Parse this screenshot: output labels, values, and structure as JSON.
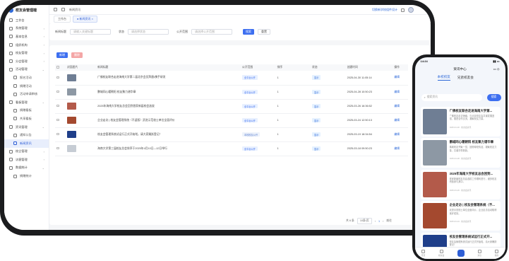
{
  "app": {
    "title": "校友会管理端"
  },
  "sidebar": {
    "items": [
      {
        "label": "工作台",
        "sub": false,
        "active": false,
        "chev": ""
      },
      {
        "label": "系统管理",
        "sub": false,
        "active": false,
        "chev": "›"
      },
      {
        "label": "基本信息",
        "sub": false,
        "active": false,
        "chev": "›"
      },
      {
        "label": "组织机构",
        "sub": false,
        "active": false,
        "chev": "›"
      },
      {
        "label": "校友管理",
        "sub": false,
        "active": false,
        "chev": "›"
      },
      {
        "label": "分会管理",
        "sub": false,
        "active": false,
        "chev": "›"
      },
      {
        "label": "活动管理",
        "sub": false,
        "active": false,
        "chev": "⌄"
      },
      {
        "label": "报名活动",
        "sub": true,
        "active": false,
        "chev": ""
      },
      {
        "label": "捐赠活动",
        "sub": true,
        "active": false,
        "chev": ""
      },
      {
        "label": "活动申请审核",
        "sub": true,
        "active": false,
        "chev": ""
      },
      {
        "label": "看板管理",
        "sub": false,
        "active": false,
        "chev": "⌄"
      },
      {
        "label": "捐赠看板",
        "sub": true,
        "active": false,
        "chev": ""
      },
      {
        "label": "共享看板",
        "sub": true,
        "active": false,
        "chev": ""
      },
      {
        "label": "资讯管理",
        "sub": false,
        "active": false,
        "chev": "⌄"
      },
      {
        "label": "通知公告",
        "sub": true,
        "active": false,
        "chev": ""
      },
      {
        "label": "新闻资讯",
        "sub": true,
        "active": true,
        "chev": ""
      },
      {
        "label": "校企管理",
        "sub": false,
        "active": false,
        "chev": "›"
      },
      {
        "label": "访客管理",
        "sub": false,
        "active": false,
        "chev": "›"
      },
      {
        "label": "数据统计",
        "sub": false,
        "active": false,
        "chev": "⌄"
      },
      {
        "label": "捐赠统计",
        "sub": true,
        "active": false,
        "chev": ""
      }
    ]
  },
  "topbar": {
    "breadcrumb": "新闻资讯",
    "link": "切换新学校组件设计"
  },
  "tabs": [
    {
      "label": "工作台",
      "on": false
    },
    {
      "label": "● 新闻资讯 ×",
      "on": true
    }
  ],
  "filters": {
    "title_label": "新闻标题",
    "title_ph": "请输入关键标题",
    "status_label": "状态",
    "status_ph": "请选择状态",
    "public_label": "公开范围",
    "public_ph": "请选择公开范围",
    "search": "搜索",
    "reset": "重置"
  },
  "toolbar": {
    "add": "新增",
    "delete": "删除"
  },
  "table": {
    "headers": [
      "",
      "封面图片",
      "新闻标题",
      "公开范围",
      "排序",
      "状态",
      "创建时间",
      "操作"
    ],
    "rows": [
      {
        "title": "广佛校友联合走进海南大学第二届北京会员拜唐•携手研发",
        "scope": "全平台公开",
        "sort": "1",
        "status": "显示",
        "time": "2025-04-30 11:05:14",
        "op": "编辑",
        "thumb": "#6f7e94"
      },
      {
        "title": "鹏城同心暖朝阳 校友聚力谱华章",
        "scope": "全平台公开",
        "sort": "1",
        "status": "显示",
        "time": "2025-04-28 10:50:23",
        "op": "编辑",
        "thumb": "#8d98a4"
      },
      {
        "title": "2025年海南大学校友总会回到首家新届校会选拔",
        "scope": "全平台公开",
        "sort": "1",
        "status": "显示",
        "time": "2025-03-26 16:36:52",
        "op": "编辑",
        "thumb": "#b35a4a"
      },
      {
        "title": "企业走访 | 校友会管理系统（不返版）武进示范校士单位全面评价",
        "scope": "全平台公开",
        "sort": "1",
        "status": "显示",
        "time": "2025-03-24 12:50:13",
        "op": "编辑",
        "thumb": "#a4492f"
      },
      {
        "title": "校友会管理系统试运行正式开始啦，请大家踊跃登记！",
        "scope": "本校校友公开",
        "sort": "1",
        "status": "显示",
        "time": "2025-03-19 18:34:54",
        "op": "编辑",
        "thumb": "#1f3f8a"
      },
      {
        "title": "海南大学第三届校友总会排序于2025年4月10日—12日举行",
        "scope": "全平台公开",
        "sort": "1",
        "status": "显示",
        "time": "2025-03-18 09:50:23",
        "op": "编辑",
        "thumb": "#c6ccd4"
      }
    ]
  },
  "pager": {
    "total": "共 6 条",
    "size": "10条/页",
    "page": "1",
    "goto": "前往"
  },
  "phone": {
    "time": "14:24",
    "title": "资讯中心",
    "more": "••• ◎",
    "tabs": [
      "本校校友",
      "兄弟校友会"
    ],
    "search_ph": "搜索资讯",
    "search_btn": "搜索",
    "items": [
      {
        "title": "广佛校友联合走进海南大学第...",
        "desc": "广佛校友走访海南，与北京校友会共谋发展蓝图，推进合作交流，凝聚校友力量。",
        "meta": "2025-04-30 · 校友会资讯",
        "img": "#6f7e94"
      },
      {
        "title": "鹏城同心暖朝阳 校友聚力谱华章",
        "desc": "鹏城校友齐聚一堂，回顾母校情谊，凝聚校友力量，共谱华章新篇。",
        "meta": "2025-04-28 · 校友会资讯",
        "img": "#8d98a4"
      },
      {
        "title": "2025年海南大学校友总会回到...",
        "desc": "首家新届校友总会选拔工作顺利进行，诸多校友积极参与其中。",
        "meta": "2025-03-26 · 校友会资讯",
        "img": "#b35a4a"
      },
      {
        "title": "企业走访 | 校友会管理系统（不...",
        "desc": "武进示范校士单位全面评价，企业走访活动取得良好成效。",
        "meta": "2025-03-24 · 校友会资讯",
        "img": "#a4492f"
      },
      {
        "title": "校友会管理系统试运行正式开...",
        "desc": "校友会管理系统试运行正式开始啦，请大家踊跃登记！",
        "meta": "2025-03-19 · 校友会资讯",
        "img": "#1f3f8a"
      }
    ],
    "nav": [
      "首页",
      "校友会",
      "",
      "消息",
      "我的"
    ]
  }
}
